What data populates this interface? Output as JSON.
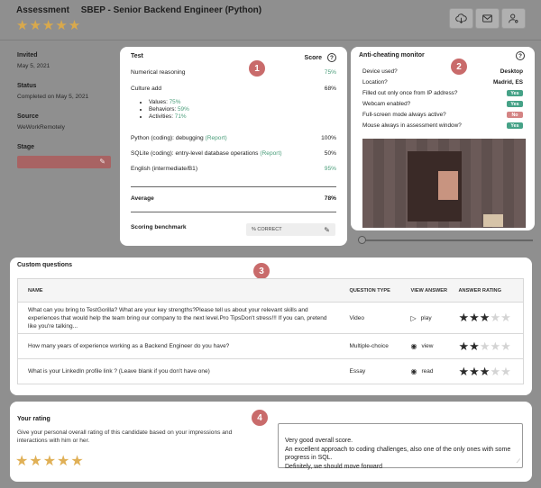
{
  "header": {
    "page_label": "Assessment",
    "job_title": "SBEP - Senior Backend Engineer (Python)",
    "stars": "★★★★★",
    "icons": [
      "cloud-download-icon",
      "mail-icon",
      "user-settings-icon"
    ]
  },
  "candidate": {
    "invited_label": "Invited",
    "invited_value": "May 5, 2021",
    "status_label": "Status",
    "status_value": "Completed on May 5, 2021",
    "source_label": "Source",
    "source_value": "WeWorkRemotely",
    "stage_label": "Stage"
  },
  "badges": [
    "1",
    "2",
    "3",
    "4"
  ],
  "tests": {
    "col_test": "Test",
    "col_score": "Score",
    "rows": [
      {
        "name": "Numerical reasoning",
        "score": "75%"
      },
      {
        "name": "Culture add",
        "score": "68%"
      },
      {
        "name": "Python (coding): debugging",
        "report": "(Report)",
        "score": "100%"
      },
      {
        "name": "SQLite (coding): entry-level database operations",
        "report": "(Report)",
        "score": "50%"
      },
      {
        "name": "English (intermediate/B1)",
        "score": "95%"
      }
    ],
    "culture_sub": [
      {
        "label": "Values:",
        "value": "75%"
      },
      {
        "label": "Behaviors:",
        "value": "59%"
      },
      {
        "label": "Activities:",
        "value": "71%"
      }
    ],
    "average_label": "Average",
    "average_value": "78%",
    "benchmark_label": "Scoring benchmark",
    "benchmark_value": "% CORRECT"
  },
  "anticheat": {
    "title": "Anti-cheating monitor",
    "rows": [
      {
        "label": "Device used?",
        "value": "Desktop",
        "kind": "text"
      },
      {
        "label": "Location?",
        "value": "Madrid, ES",
        "kind": "text"
      },
      {
        "label": "Filled out only once from IP address?",
        "value": "Yes",
        "kind": "yes"
      },
      {
        "label": "Webcam enabled?",
        "value": "Yes",
        "kind": "yes"
      },
      {
        "label": "Full-screen mode always active?",
        "value": "No",
        "kind": "no"
      },
      {
        "label": "Mouse always in assessment window?",
        "value": "Yes",
        "kind": "yes"
      }
    ],
    "slider_position": 0
  },
  "custom_questions": {
    "title": "Custom questions",
    "headers": [
      "NAME",
      "QUESTION TYPE",
      "VIEW ANSWER",
      "ANSWER RATING"
    ],
    "rows": [
      {
        "name": "What can you bring to TestGorilla? What are your key strengths?Please tell us about your relevant skills and experiences that would help the team bring our company to the next level.Pro TipsDon't stress!!! If you can, pretend like you're talking...",
        "type": "Video",
        "view": "play",
        "view_icon": "play-icon",
        "rating": 3
      },
      {
        "name": "How many years of experience working as a Backend Engineer do you have?",
        "type": "Multiple-choice",
        "view": "view",
        "view_icon": "eye-icon",
        "rating": 2
      },
      {
        "name": "What is your LinkedIn profile link ? (Leave blank if you don't have one)",
        "type": "Essay",
        "view": "read",
        "view_icon": "eye-icon",
        "rating": 3
      }
    ]
  },
  "your_rating": {
    "title": "Your rating",
    "description": "Give your personal overall rating of this candidate based on your impressions and interactions with him or her.",
    "stars": "★★★★★",
    "comment": "Very good overall score.\nAn excellent approach to coding challenges, also one of the only ones with some progress in SQL.\nDefinitely, we should move forward"
  },
  "colors": {
    "accent_star": "#d9a94c",
    "badge": "#c96b6b",
    "yes": "#46a287",
    "no": "#d48484",
    "link_green": "#4a9d7a"
  }
}
